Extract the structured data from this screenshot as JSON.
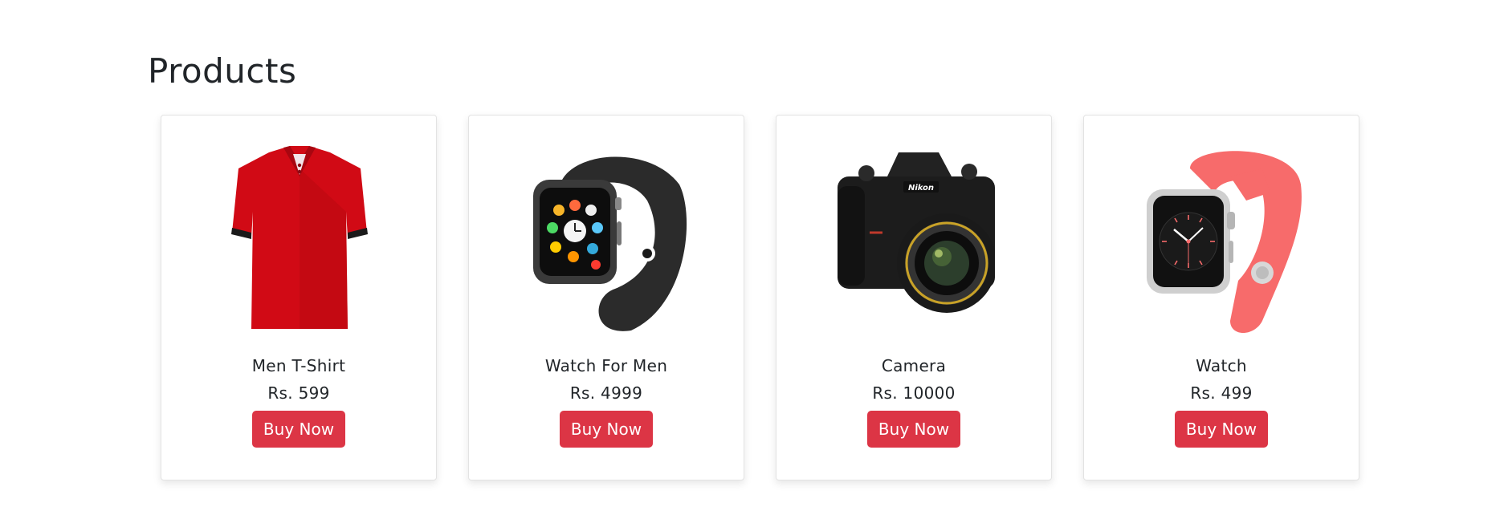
{
  "page": {
    "title": "Products"
  },
  "theme": {
    "accent": "#dc3545"
  },
  "products": [
    {
      "name": "Men T-Shirt",
      "price": "Rs. 599",
      "button": "Buy Now",
      "image_icon": "red-tshirt-image"
    },
    {
      "name": "Watch For Men",
      "price": "Rs. 4999",
      "button": "Buy Now",
      "image_icon": "black-smartwatch-image"
    },
    {
      "name": "Camera",
      "price": "Rs. 10000",
      "button": "Buy Now",
      "image_icon": "dslr-camera-image"
    },
    {
      "name": "Watch",
      "price": "Rs. 499",
      "button": "Buy Now",
      "image_icon": "pink-smartwatch-image"
    }
  ]
}
